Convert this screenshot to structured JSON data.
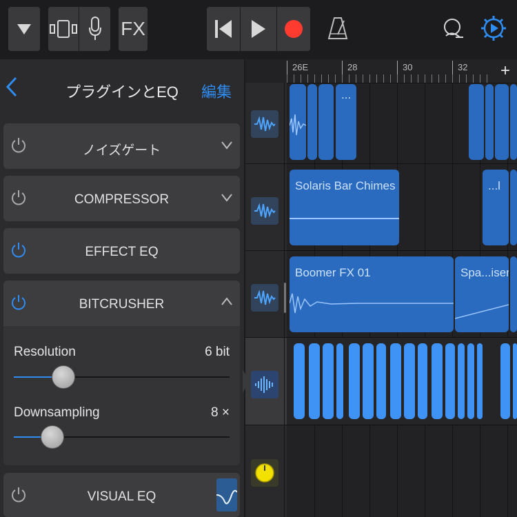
{
  "toolbar": {
    "browser_icon": "triangle-down-icon",
    "tracks_icon": "tracks-view-icon",
    "mic_icon": "microphone-icon",
    "fx_label": "FX",
    "rewind_icon": "skip-back-icon",
    "play_icon": "play-icon",
    "record_icon": "record-icon",
    "metronome_icon": "metronome-icon",
    "loop_icon": "loop-browser-icon",
    "settings_icon": "settings-gear-icon",
    "accent": "#2f8cf0",
    "record_color": "#ff3b30"
  },
  "panel": {
    "title": "プラグインとEQ",
    "edit_label": "編集",
    "plugins": [
      {
        "name": "ノイズゲート",
        "on": false,
        "expanded": false
      },
      {
        "name": "COMPRESSOR",
        "on": false,
        "expanded": false
      },
      {
        "name": "EFFECT EQ",
        "on": true,
        "expanded": false
      },
      {
        "name": "BITCRUSHER",
        "on": true,
        "expanded": true
      },
      {
        "name": "VISUAL EQ",
        "on": false,
        "expanded": false
      }
    ],
    "bitcrusher": {
      "resolution_label": "Resolution",
      "resolution_value": "6 bit",
      "resolution_level": 0.23,
      "downsampling_label": "Downsampling",
      "downsampling_value": "8 ×",
      "downsampling_level": 0.18
    }
  },
  "ruler": {
    "marks": [
      "26E",
      "28",
      "30",
      "32"
    ],
    "add_label": "+"
  },
  "regions": {
    "track1_dots": "...",
    "track2_a": "Solaris Bar Chimes",
    "track2_b": "...l",
    "track3_a": "Boomer FX 01",
    "track3_b": "Spa...iser"
  },
  "colors": {
    "region": "#2a6bc0",
    "region_bright": "#3f93f5",
    "selected_track": "#3a3a3c",
    "knob_yellow": "#f2e000"
  }
}
